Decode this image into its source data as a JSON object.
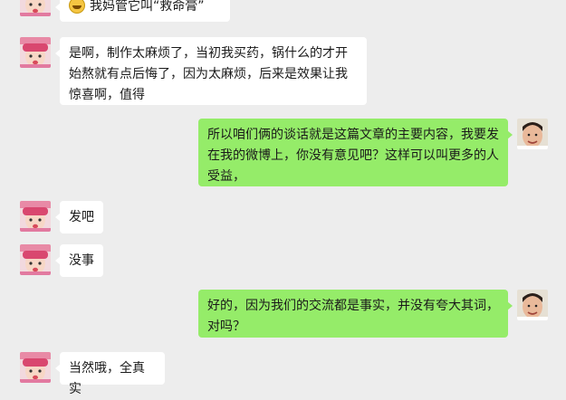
{
  "messages": [
    {
      "side": "left",
      "text": "我妈管它叫“救命膏”",
      "has_emoji": true
    },
    {
      "side": "left",
      "text": "是啊，制作太麻烦了，当初我买药，锅什么的才开始熬就有点后悔了，因为太麻烦，后来是效果让我惊喜啊，值得"
    },
    {
      "side": "right",
      "text": "所以咱们俩的谈话就是这篇文章的主要内容，我要发在我的微博上，你没有意见吧？这样可以叫更多的人受益，"
    },
    {
      "side": "left",
      "text": "发吧"
    },
    {
      "side": "left",
      "text": "没事"
    },
    {
      "side": "right",
      "text": "好的，因为我们的交流都是事实，并没有夸大其词，对吗？"
    },
    {
      "side": "left",
      "text": "当然哦，全真实"
    }
  ],
  "icons": {
    "left_avatar": "child-avatar-icon",
    "right_avatar": "man-avatar-icon",
    "emoji": "grinning-emoji-icon"
  },
  "colors": {
    "background": "#ededed",
    "left_bubble": "#ffffff",
    "right_bubble": "#95ec69"
  }
}
